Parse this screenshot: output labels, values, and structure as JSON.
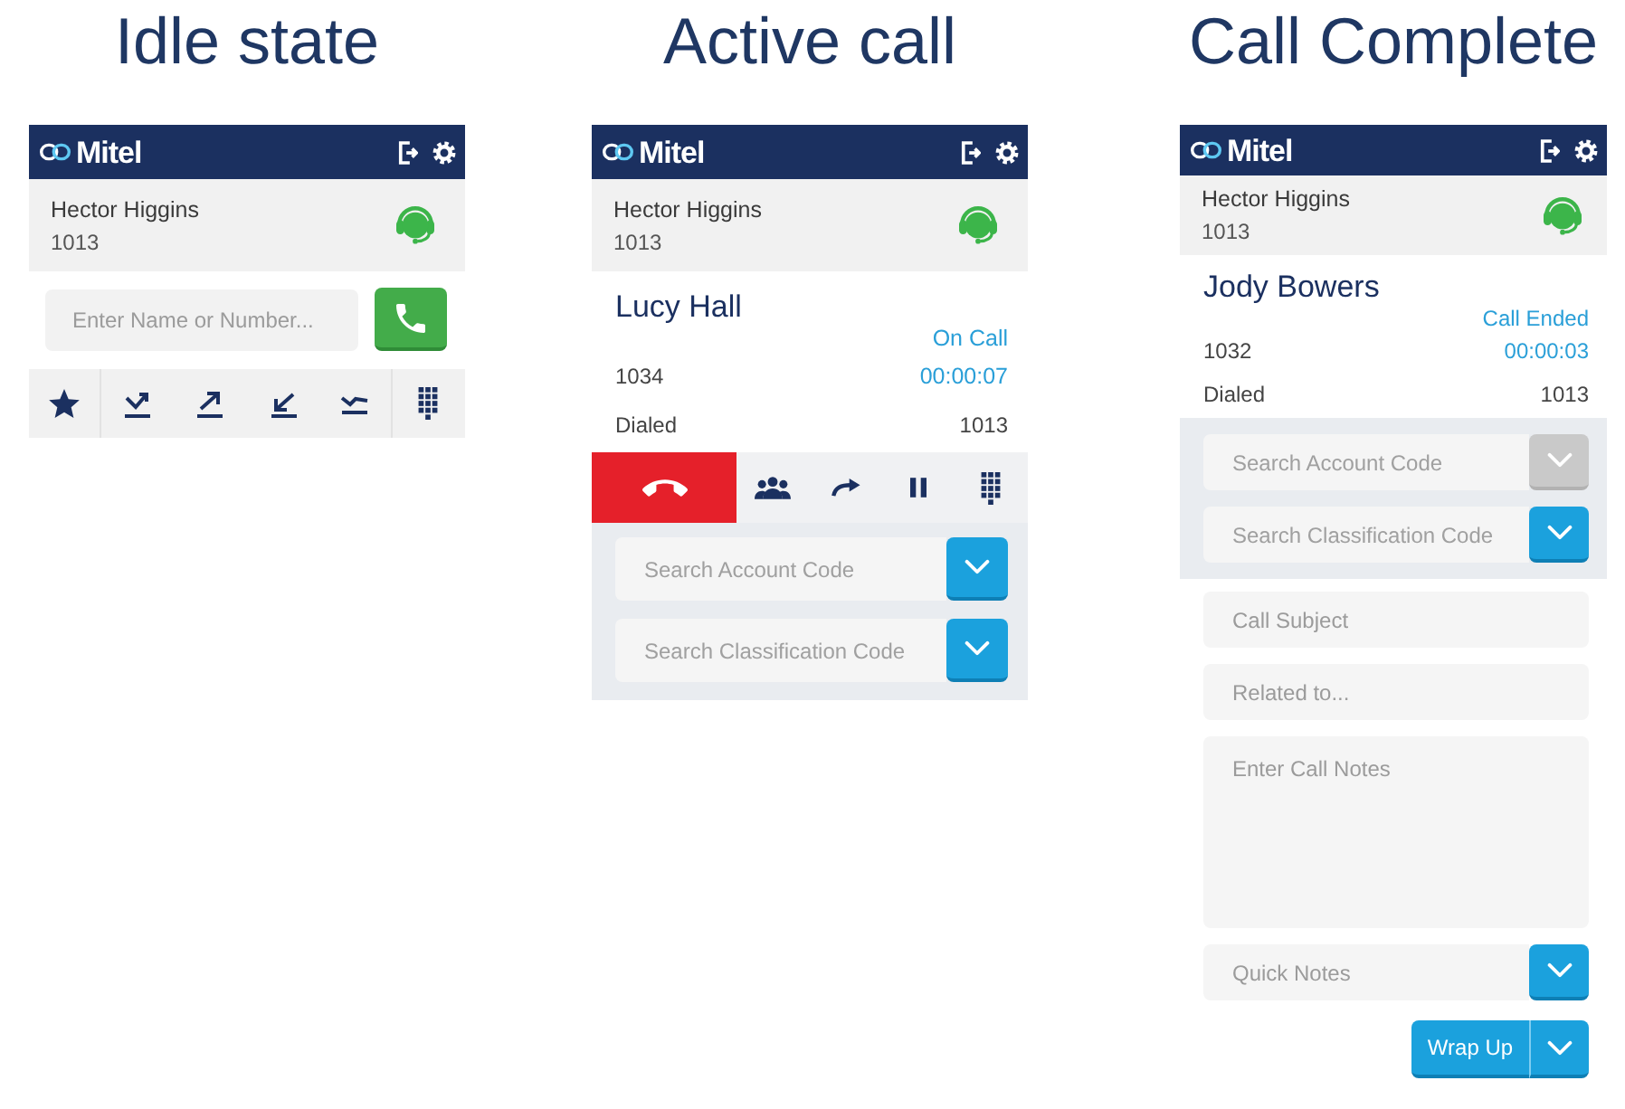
{
  "screens": [
    {
      "kind": "idle",
      "title": "Idle state",
      "header": {
        "brand": "Mitel"
      },
      "agent": {
        "name": "Hector Higgins",
        "extension": "1013"
      },
      "dial_field": {
        "placeholder": "Enter Name or Number..."
      }
    },
    {
      "kind": "active",
      "title": "Active call",
      "header": {
        "brand": "Mitel"
      },
      "agent": {
        "name": "Hector Higgins",
        "extension": "1013"
      },
      "call": {
        "contact": "Lucy Hall",
        "status": "On Call",
        "number": "1034",
        "duration": "00:00:07",
        "direction": "Dialed",
        "dialed_number": "1013"
      },
      "code_fields": [
        {
          "placeholder": "Search Account Code",
          "disabled": false
        },
        {
          "placeholder": "Search Classification Code",
          "disabled": false
        }
      ]
    },
    {
      "kind": "complete",
      "title": "Call Complete",
      "header": {
        "brand": "Mitel"
      },
      "agent": {
        "name": "Hector Higgins",
        "extension": "1013"
      },
      "call": {
        "contact": "Jody Bowers",
        "status": "Call Ended",
        "number": "1032",
        "duration": "00:00:03",
        "direction": "Dialed",
        "dialed_number": "1013"
      },
      "code_fields": [
        {
          "placeholder": "Search Account Code",
          "disabled": true
        },
        {
          "placeholder": "Search Classification Code",
          "disabled": false
        }
      ],
      "wrap_fields": [
        {
          "kind": "text",
          "placeholder": "Call Subject"
        },
        {
          "kind": "text",
          "placeholder": "Related to..."
        },
        {
          "kind": "notes",
          "placeholder": "Enter Call Notes"
        },
        {
          "kind": "dropdown",
          "placeholder": "Quick Notes"
        }
      ],
      "wrap_button": {
        "label": "Wrap Up"
      }
    }
  ]
}
